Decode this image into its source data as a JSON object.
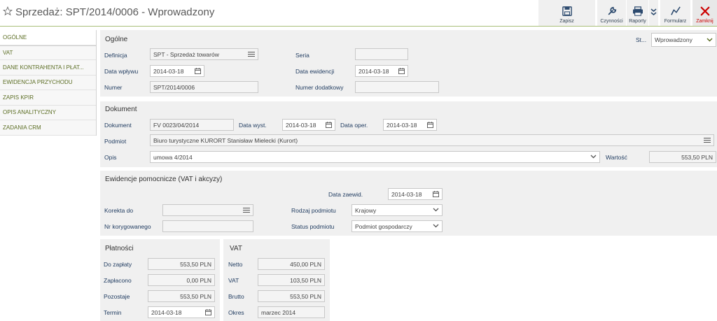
{
  "header": {
    "title": "Sprzedaż: SPT/2014/0006 - Wprowadzony"
  },
  "toolbar": {
    "save": "Zapisz",
    "actions": "Czynności",
    "reports": "Raporty",
    "form": "Formularz",
    "close": "Zamknij"
  },
  "sidebar": {
    "items": [
      {
        "label": "OGÓLNE"
      },
      {
        "label": "VAT"
      },
      {
        "label": "DANE KONTRAHENTA I PŁAT..."
      },
      {
        "label": "EWIDENCJA PRZYCHODU"
      },
      {
        "label": "ZAPIS KPIR"
      },
      {
        "label": "OPIS ANALITYCZNY"
      },
      {
        "label": "ZADANIA CRM"
      }
    ]
  },
  "general": {
    "title": "Ogólne",
    "status_label": "St...",
    "status_value": "Wprowadzony",
    "definition_label": "Definicja",
    "definition_value": "SPT - Sprzedaż towarów",
    "series_label": "Seria",
    "series_value": "",
    "receipt_date_label": "Data wpływu",
    "receipt_date_value": "2014-03-18",
    "record_date_label": "Data ewidencji",
    "record_date_value": "2014-03-18",
    "number_label": "Numer",
    "number_value": "SPT/2014/0006",
    "extra_number_label": "Numer dodatkowy",
    "extra_number_value": ""
  },
  "document": {
    "title": "Dokument",
    "doc_label": "Dokument",
    "doc_value": "FV 0023/04/2014",
    "issue_date_label": "Data wyst.",
    "issue_date_value": "2014-03-18",
    "oper_date_label": "Data oper.",
    "oper_date_value": "2014-03-18",
    "entity_label": "Podmiot",
    "entity_value": "Biuro turystyczne KURORT Stanisław Mielecki  (Kurort)",
    "desc_label": "Opis",
    "desc_value": "umowa 4/2014",
    "value_label": "Wartość",
    "value_value": "553,50 PLN"
  },
  "auxiliary": {
    "title": "Ewidencje pomocnicze (VAT i akcyzy)",
    "date_label": "Data zaewid.",
    "date_value": "2014-03-18",
    "correction_label": "Korekta do",
    "correction_value": "",
    "entity_type_label": "Rodzaj podmiotu",
    "entity_type_value": "Krajowy",
    "corrected_label": "Nr korygowanego",
    "corrected_value": "",
    "entity_status_label": "Status podmiotu",
    "entity_status_value": "Podmiot gospodarczy"
  },
  "payments": {
    "title": "Płatności",
    "to_pay_label": "Do zapłaty",
    "to_pay_value": "553,50 PLN",
    "paid_label": "Zapłacono",
    "paid_value": "0,00 PLN",
    "remaining_label": "Pozostaje",
    "remaining_value": "553,50 PLN",
    "term_label": "Termin",
    "term_value": "2014-03-18"
  },
  "vat": {
    "title": "VAT",
    "net_label": "Netto",
    "net_value": "450,00 PLN",
    "vat_label": "VAT",
    "vat_value": "103,50 PLN",
    "gross_label": "Brutto",
    "gross_value": "553,50 PLN",
    "period_label": "Okres",
    "period_value": "marzec 2014"
  },
  "colors": {
    "accent": "#5c6e24",
    "label": "#1e3a5f",
    "close": "#cc0000",
    "panel": "#f0f0f0"
  },
  "icons": [
    "star-icon",
    "save-icon",
    "wrench-icon",
    "printer-icon",
    "chevron-down-icon",
    "form-icon",
    "close-icon",
    "calendar-icon",
    "list-icon"
  ]
}
